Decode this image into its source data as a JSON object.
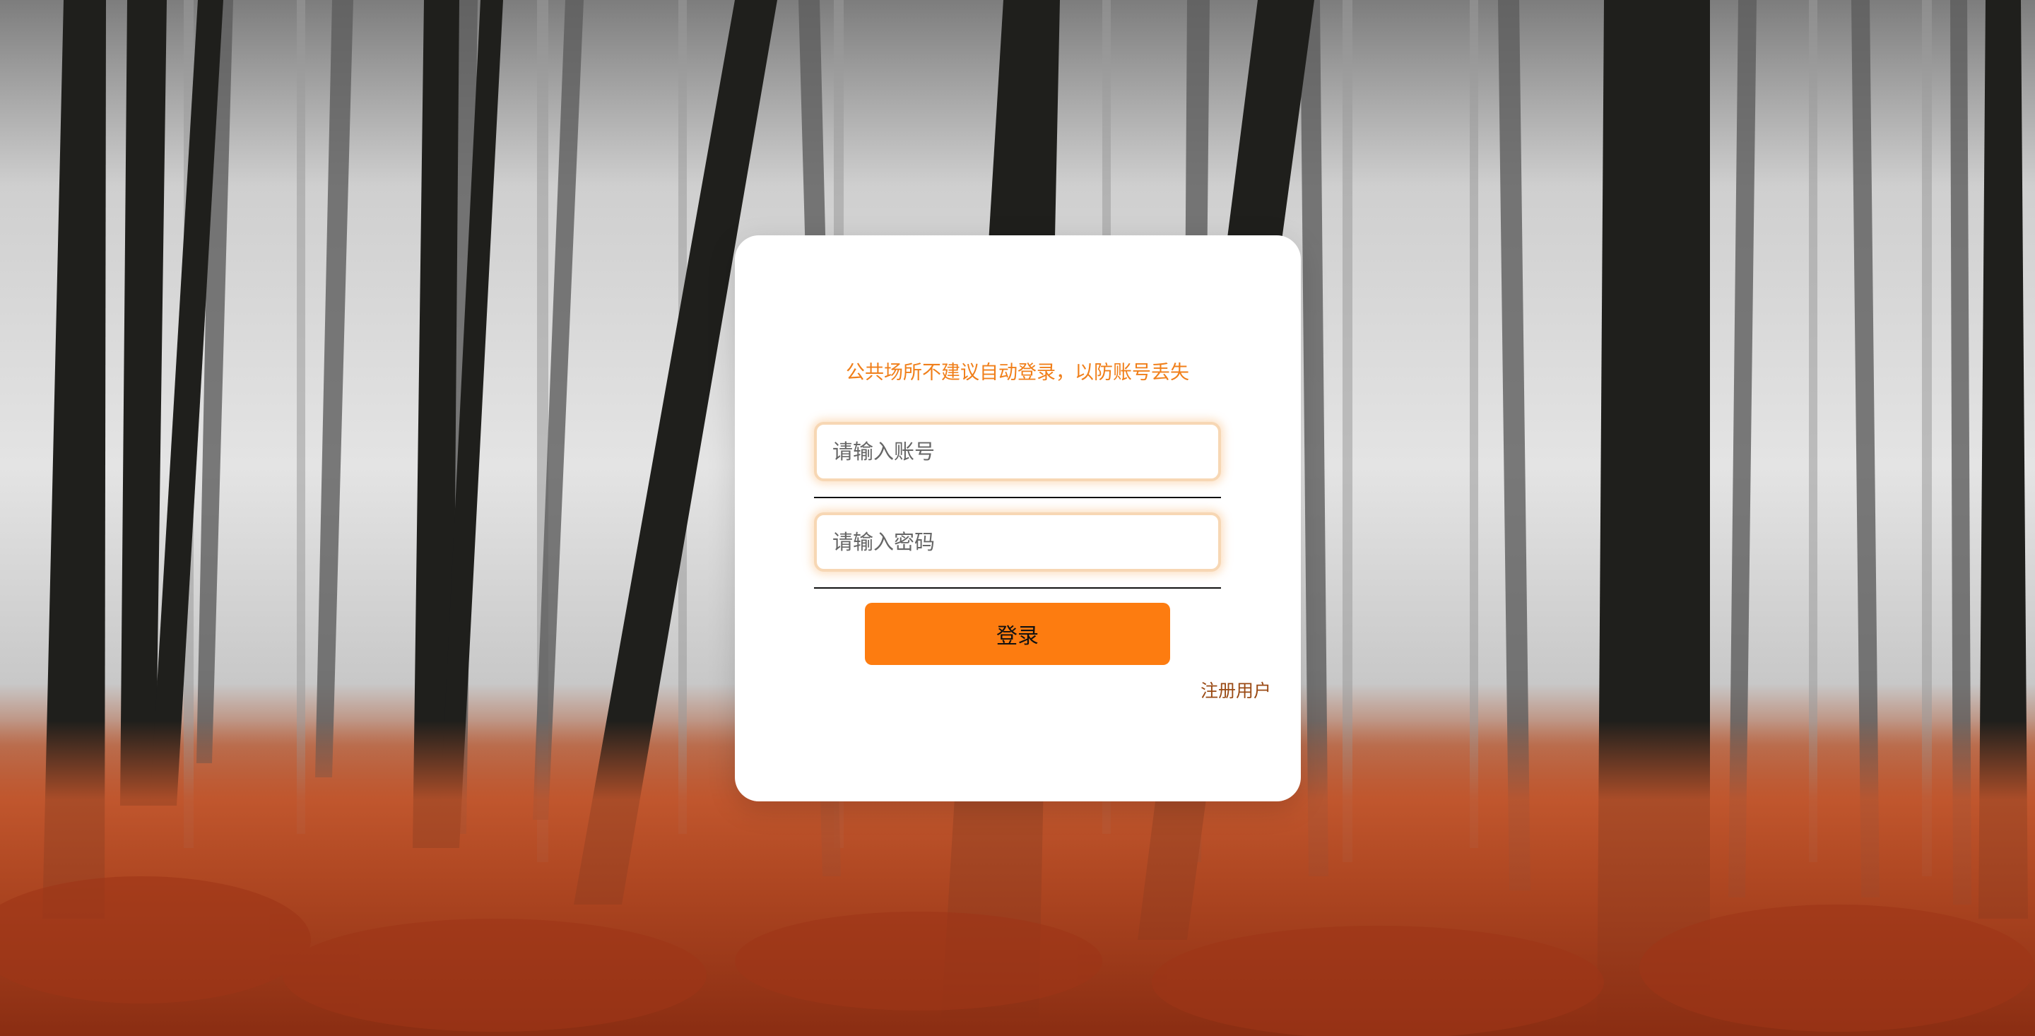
{
  "login": {
    "notice": "公共场所不建议自动登录，以防账号丢失",
    "account_placeholder": "请输入账号",
    "password_placeholder": "请输入密码",
    "login_label": "登录",
    "register_label": "注册用户"
  },
  "colors": {
    "accent": "#fd7c10",
    "notice": "#f07f1a",
    "link": "#9a4a14"
  }
}
